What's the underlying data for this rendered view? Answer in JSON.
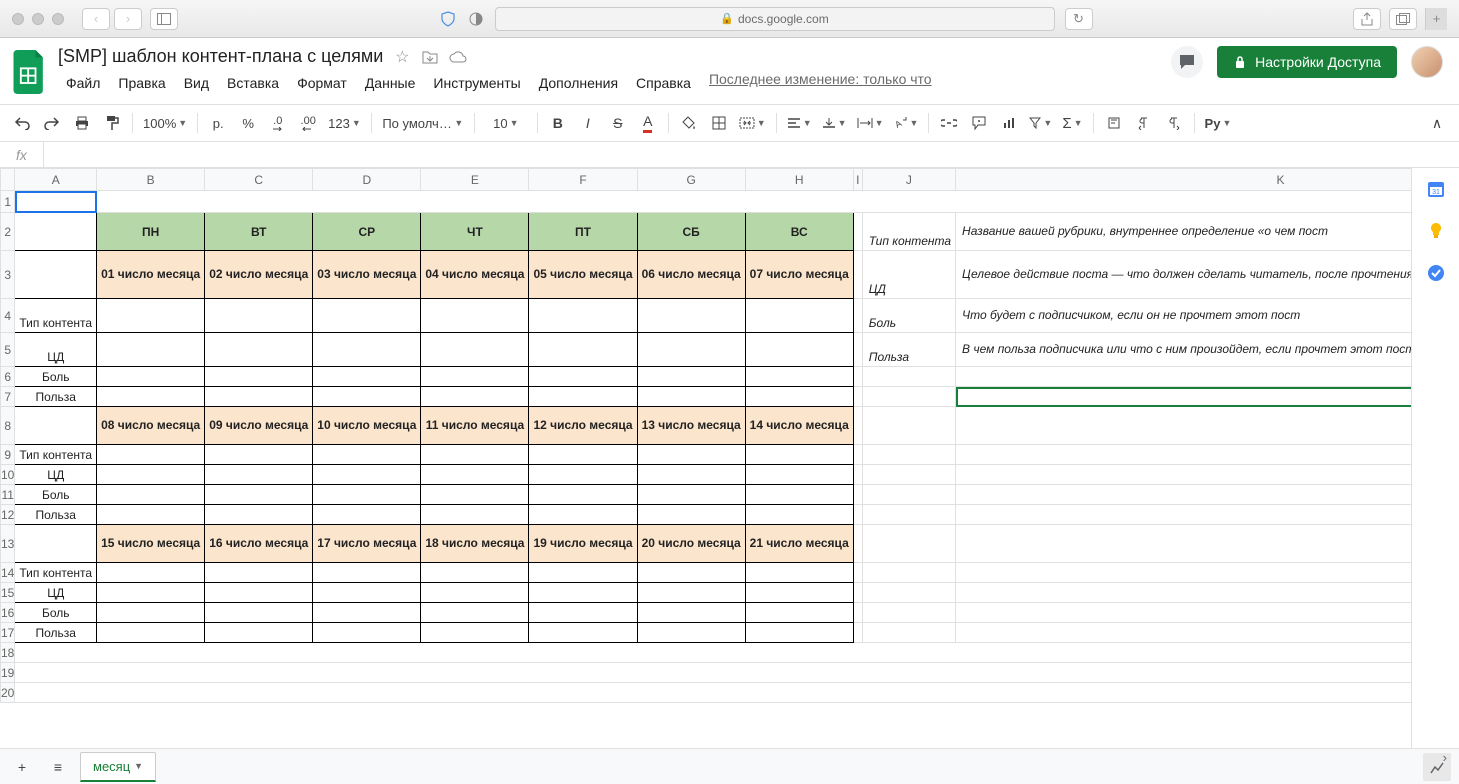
{
  "browser": {
    "url_host": "docs.google.com"
  },
  "doc": {
    "title": "[SMP] шаблон контент-плана с целями",
    "last_edit": "Последнее изменение: только что"
  },
  "menubar": [
    "Файл",
    "Правка",
    "Вид",
    "Вставка",
    "Формат",
    "Данные",
    "Инструменты",
    "Дополнения",
    "Справка"
  ],
  "share_label": "Настройки Доступа",
  "toolbar": {
    "zoom": "100%",
    "currency": "р.",
    "percent": "%",
    "dec_dec": ".0",
    "inc_dec": ".00",
    "numfmt": "123",
    "font": "По умолча…",
    "fontsize": "10",
    "ext": "Py"
  },
  "formula": {
    "fx": "fx",
    "value": ""
  },
  "columns": [
    "A",
    "B",
    "C",
    "D",
    "E",
    "F",
    "G",
    "H",
    "I",
    "J",
    "K"
  ],
  "days": [
    "ПН",
    "ВТ",
    "СР",
    "ЧТ",
    "ПТ",
    "СБ",
    "ВС"
  ],
  "dates": {
    "w1": [
      "01 число месяца",
      "02 число месяца",
      "03 число месяца",
      "04 число месяца",
      "05 число месяца",
      "06 число месяца",
      "07 число месяца"
    ],
    "w2": [
      "08 число месяца",
      "09 число месяца",
      "10 число месяца",
      "11 число месяца",
      "12 число месяца",
      "13 число месяца",
      "14 число месяца"
    ],
    "w3": [
      "15 число месяца",
      "16 число месяца",
      "17 число месяца",
      "18 число месяца",
      "19 число месяца",
      "20 число месяца",
      "21 число месяца"
    ]
  },
  "rowlabels": {
    "type": "Тип контента",
    "cd": "ЦД",
    "pain": "Боль",
    "use": "Польза"
  },
  "legend": {
    "j2": "Тип контента",
    "k2": "Название вашей рубрики, внутреннее определение «о чем пост",
    "j3": "ЦД",
    "k3": "Целевое действие поста — что должен сделать читатель, после прочтения. Как раз и есть «фокус на цели»",
    "j4": "Боль",
    "k4": "Что будет с подписчиком, если он не прочтет этот пост",
    "j5": "Польза",
    "k5": "В чем польза подписчика или что с ним произойдет, если прочтет этот пост"
  },
  "sheet_tab": "месяц"
}
